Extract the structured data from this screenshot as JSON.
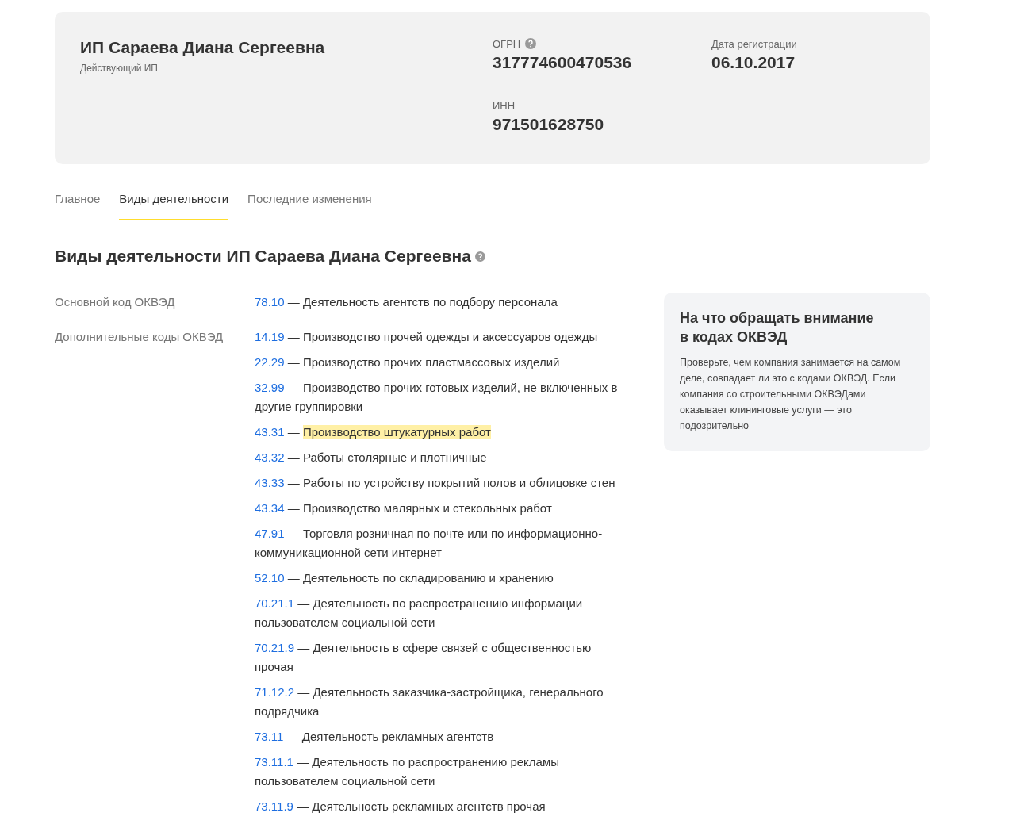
{
  "header": {
    "name": "ИП Сараева Диана Сергеевна",
    "status": "Действующий ИП",
    "fields": [
      {
        "label": "ОГРН",
        "value": "317774600470536",
        "help": true
      },
      {
        "label": "Дата регистрации",
        "value": "06.10.2017",
        "help": false
      },
      {
        "label": "ИНН",
        "value": "971501628750",
        "help": false
      }
    ]
  },
  "tabs": [
    {
      "label": "Главное",
      "selected": false
    },
    {
      "label": "Виды деятельности",
      "selected": true
    },
    {
      "label": "Последние изменения",
      "selected": false
    }
  ],
  "section_title": "Виды деятельности ИП Сараева Диана Сергеевна",
  "groups": [
    {
      "label": "Основной код ОКВЭД",
      "items": [
        {
          "code": "78.10",
          "dash": "—",
          "name": "Деятельность агентств по подбору персонала",
          "highlighted": false
        }
      ]
    },
    {
      "label": "Дополнительные коды ОКВЭД",
      "items": [
        {
          "code": "14.19",
          "dash": "—",
          "name": "Производство прочей одежды и аксессуаров одежды",
          "highlighted": false
        },
        {
          "code": "22.29",
          "dash": "—",
          "name": "Производство прочих пластмассовых изделий",
          "highlighted": false
        },
        {
          "code": "32.99",
          "dash": "—",
          "name": "Производство прочих готовых изделий, не включенных в другие группировки",
          "highlighted": false
        },
        {
          "code": "43.31",
          "dash": "—",
          "name": "Производство штукатурных работ",
          "highlighted": true
        },
        {
          "code": "43.32",
          "dash": "—",
          "name": "Работы столярные и плотничные",
          "highlighted": false
        },
        {
          "code": "43.33",
          "dash": "—",
          "name": "Работы по устройству покрытий полов и облицовке стен",
          "highlighted": false
        },
        {
          "code": "43.34",
          "dash": "—",
          "name": "Производство малярных и стекольных работ",
          "highlighted": false
        },
        {
          "code": "47.91",
          "dash": "—",
          "name": "Торговля розничная по почте или по информационно-коммуникационной сети интернет",
          "highlighted": false
        },
        {
          "code": "52.10",
          "dash": "—",
          "name": "Деятельность по складированию и хранению",
          "highlighted": false
        },
        {
          "code": "70.21.1",
          "dash": "—",
          "name": "Деятельность по распространению информации пользователем социальной сети",
          "highlighted": false
        },
        {
          "code": "70.21.9",
          "dash": "—",
          "name": "Деятельность в сфере связей с общественностью прочая",
          "highlighted": false
        },
        {
          "code": "71.12.2",
          "dash": "—",
          "name": "Деятельность заказчика-застройщика, генерального подрядчика",
          "highlighted": false
        },
        {
          "code": "73.11",
          "dash": "—",
          "name": "Деятельность рекламных агентств",
          "highlighted": false
        },
        {
          "code": "73.11.1",
          "dash": "—",
          "name": "Деятельность по распространению рекламы пользователем социальной сети",
          "highlighted": false
        },
        {
          "code": "73.11.9",
          "dash": "—",
          "name": "Деятельность рекламных агентств прочая",
          "highlighted": false
        }
      ]
    }
  ],
  "aside": {
    "title": "На что обращать внимание в кодах ОКВЭД",
    "text": "Проверьте, чем компания занимается на самом деле, совпадает ли это с кодами ОКВЭД. Если компания со строительными ОКВЭДами оказывает клининговые услуги — это подозрительно"
  }
}
